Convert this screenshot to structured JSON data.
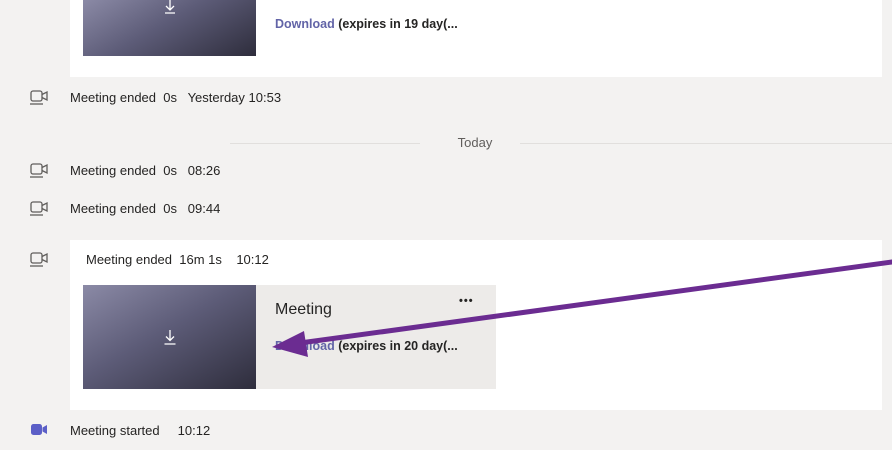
{
  "top_recording": {
    "download_label": "Download",
    "expires": "(expires in 19 day(..."
  },
  "events": [
    {
      "text": "Meeting ended  0s   Yesterday 10:53"
    },
    {
      "text": "Meeting ended  0s   08:26"
    },
    {
      "text": "Meeting ended  0s   09:44"
    }
  ],
  "day_divider": "Today",
  "recording_event": {
    "text": "Meeting ended  16m 1s    10:12",
    "recording": {
      "title": "Meeting",
      "more_label": "•••",
      "download_label": "Download",
      "expires": "(expires in 20 day(..."
    }
  },
  "started_event": {
    "text": "Meeting started     10:12"
  },
  "colors": {
    "background": "#f3f2f1",
    "card": "#ffffff",
    "link": "#6264a7",
    "arrow": "#6b2c91"
  }
}
